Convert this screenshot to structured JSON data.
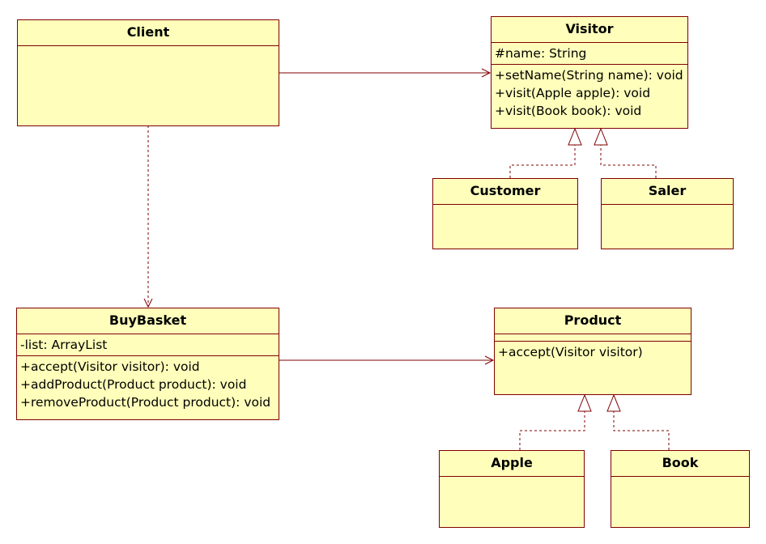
{
  "classes": {
    "client": {
      "name": "Client"
    },
    "visitor": {
      "name": "Visitor",
      "attributes": [
        "#name: String"
      ],
      "operations": [
        "+setName(String name): void",
        "+visit(Apple apple): void",
        "+visit(Book book): void"
      ]
    },
    "customer": {
      "name": "Customer"
    },
    "saler": {
      "name": "Saler"
    },
    "buybasket": {
      "name": "BuyBasket",
      "attributes": [
        "-list: ArrayList"
      ],
      "operations": [
        "+accept(Visitor visitor): void",
        "+addProduct(Product product): void",
        "+removeProduct(Product product): void"
      ]
    },
    "product": {
      "name": "Product",
      "operations": [
        "+accept(Visitor visitor)"
      ]
    },
    "apple": {
      "name": "Apple"
    },
    "book": {
      "name": "Book"
    }
  },
  "colors": {
    "line": "#800000",
    "fill": "#ffffbb"
  }
}
